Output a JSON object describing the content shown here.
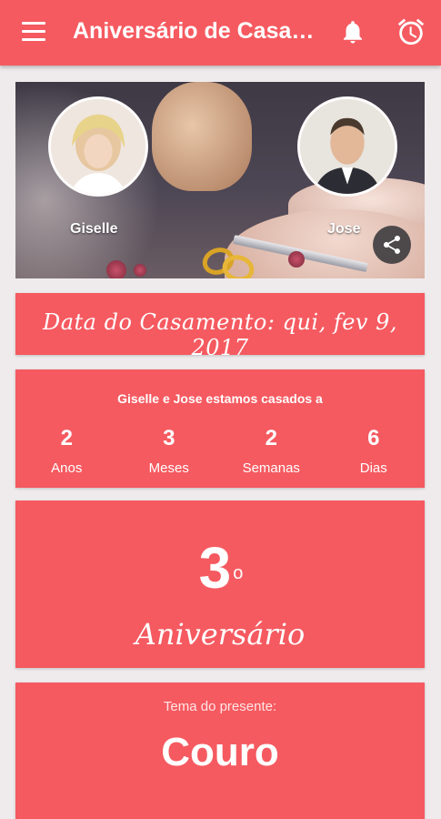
{
  "appbar": {
    "title": "Aniversário de Casa…",
    "icons": {
      "menu": "menu-icon",
      "notifications": "bell-icon",
      "alarm": "alarm-clock-icon"
    }
  },
  "hero": {
    "partner1_name": "Giselle",
    "partner2_name": "Jose",
    "share_icon": "share-icon"
  },
  "wedding_date": {
    "text": "Data do Casamento: qui, fev 9, 2017"
  },
  "counter": {
    "heading": "Giselle e Jose estamos casados a",
    "units": [
      {
        "value": "2",
        "label": "Anos"
      },
      {
        "value": "3",
        "label": "Meses"
      },
      {
        "value": "2",
        "label": "Semanas"
      },
      {
        "value": "6",
        "label": "Dias"
      }
    ]
  },
  "anniversary": {
    "number": "3",
    "ordinal": "o",
    "label": "Aniversário"
  },
  "gift": {
    "label": "Tema do presente:",
    "value": "Couro"
  },
  "colors": {
    "accent": "#f55a60",
    "background": "#efebec",
    "text": "#ffffff"
  }
}
